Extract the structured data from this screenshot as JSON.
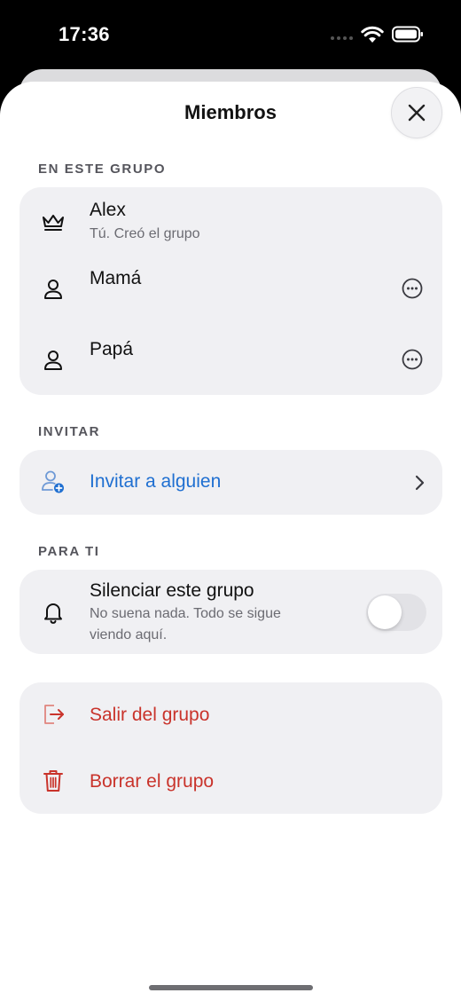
{
  "status_bar": {
    "time": "17:36"
  },
  "sheet": {
    "title": "Miembros"
  },
  "members_section": {
    "label": "EN ESTE GRUPO",
    "members": [
      {
        "name": "Alex",
        "subtitle": "Tú. Creó el grupo",
        "icon": "crown-icon"
      },
      {
        "name": "Mamá",
        "icon": "person-icon"
      },
      {
        "name": "Papá",
        "icon": "person-icon"
      }
    ]
  },
  "invite_section": {
    "label": "INVITAR",
    "action": "Invitar a alguien",
    "icon": "person-add-icon"
  },
  "for_you_section": {
    "label": "PARA TI",
    "mute_title": "Silenciar este grupo",
    "mute_desc_line1": "No suena nada. Todo se sigue",
    "mute_desc_line2": "viendo aquí.",
    "mute_enabled": false
  },
  "danger_section": {
    "leave": "Salir del grupo",
    "delete": "Borrar el grupo"
  },
  "colors": {
    "accent_blue": "#1f6fd1",
    "danger_red": "#c9332b",
    "card_bg": "#f0f0f3"
  }
}
